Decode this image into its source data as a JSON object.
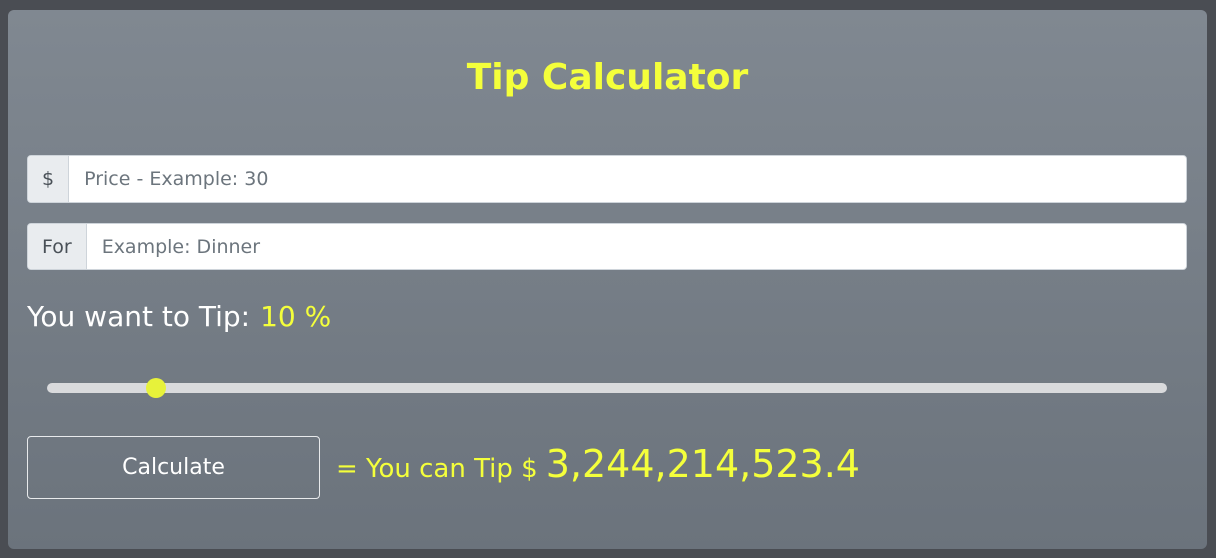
{
  "app": {
    "title": "Tip Calculator"
  },
  "price_field": {
    "addon": "$",
    "placeholder": "Price - Example: 30",
    "value": ""
  },
  "for_field": {
    "addon": "For",
    "placeholder": "Example: Dinner",
    "value": ""
  },
  "tip": {
    "label": "You want to Tip:",
    "percent_text": "10 %",
    "percent_value": 10
  },
  "slider": {
    "value_fraction": 0.097
  },
  "calculate": {
    "label": "Calculate"
  },
  "result": {
    "prefix": "= You can Tip $",
    "amount": "3,244,214,523.4"
  },
  "colors": {
    "accent": "#f4ff3b",
    "card_top": "#808891",
    "card_bottom": "#6b737c",
    "page_bg": "#4a4d53"
  }
}
